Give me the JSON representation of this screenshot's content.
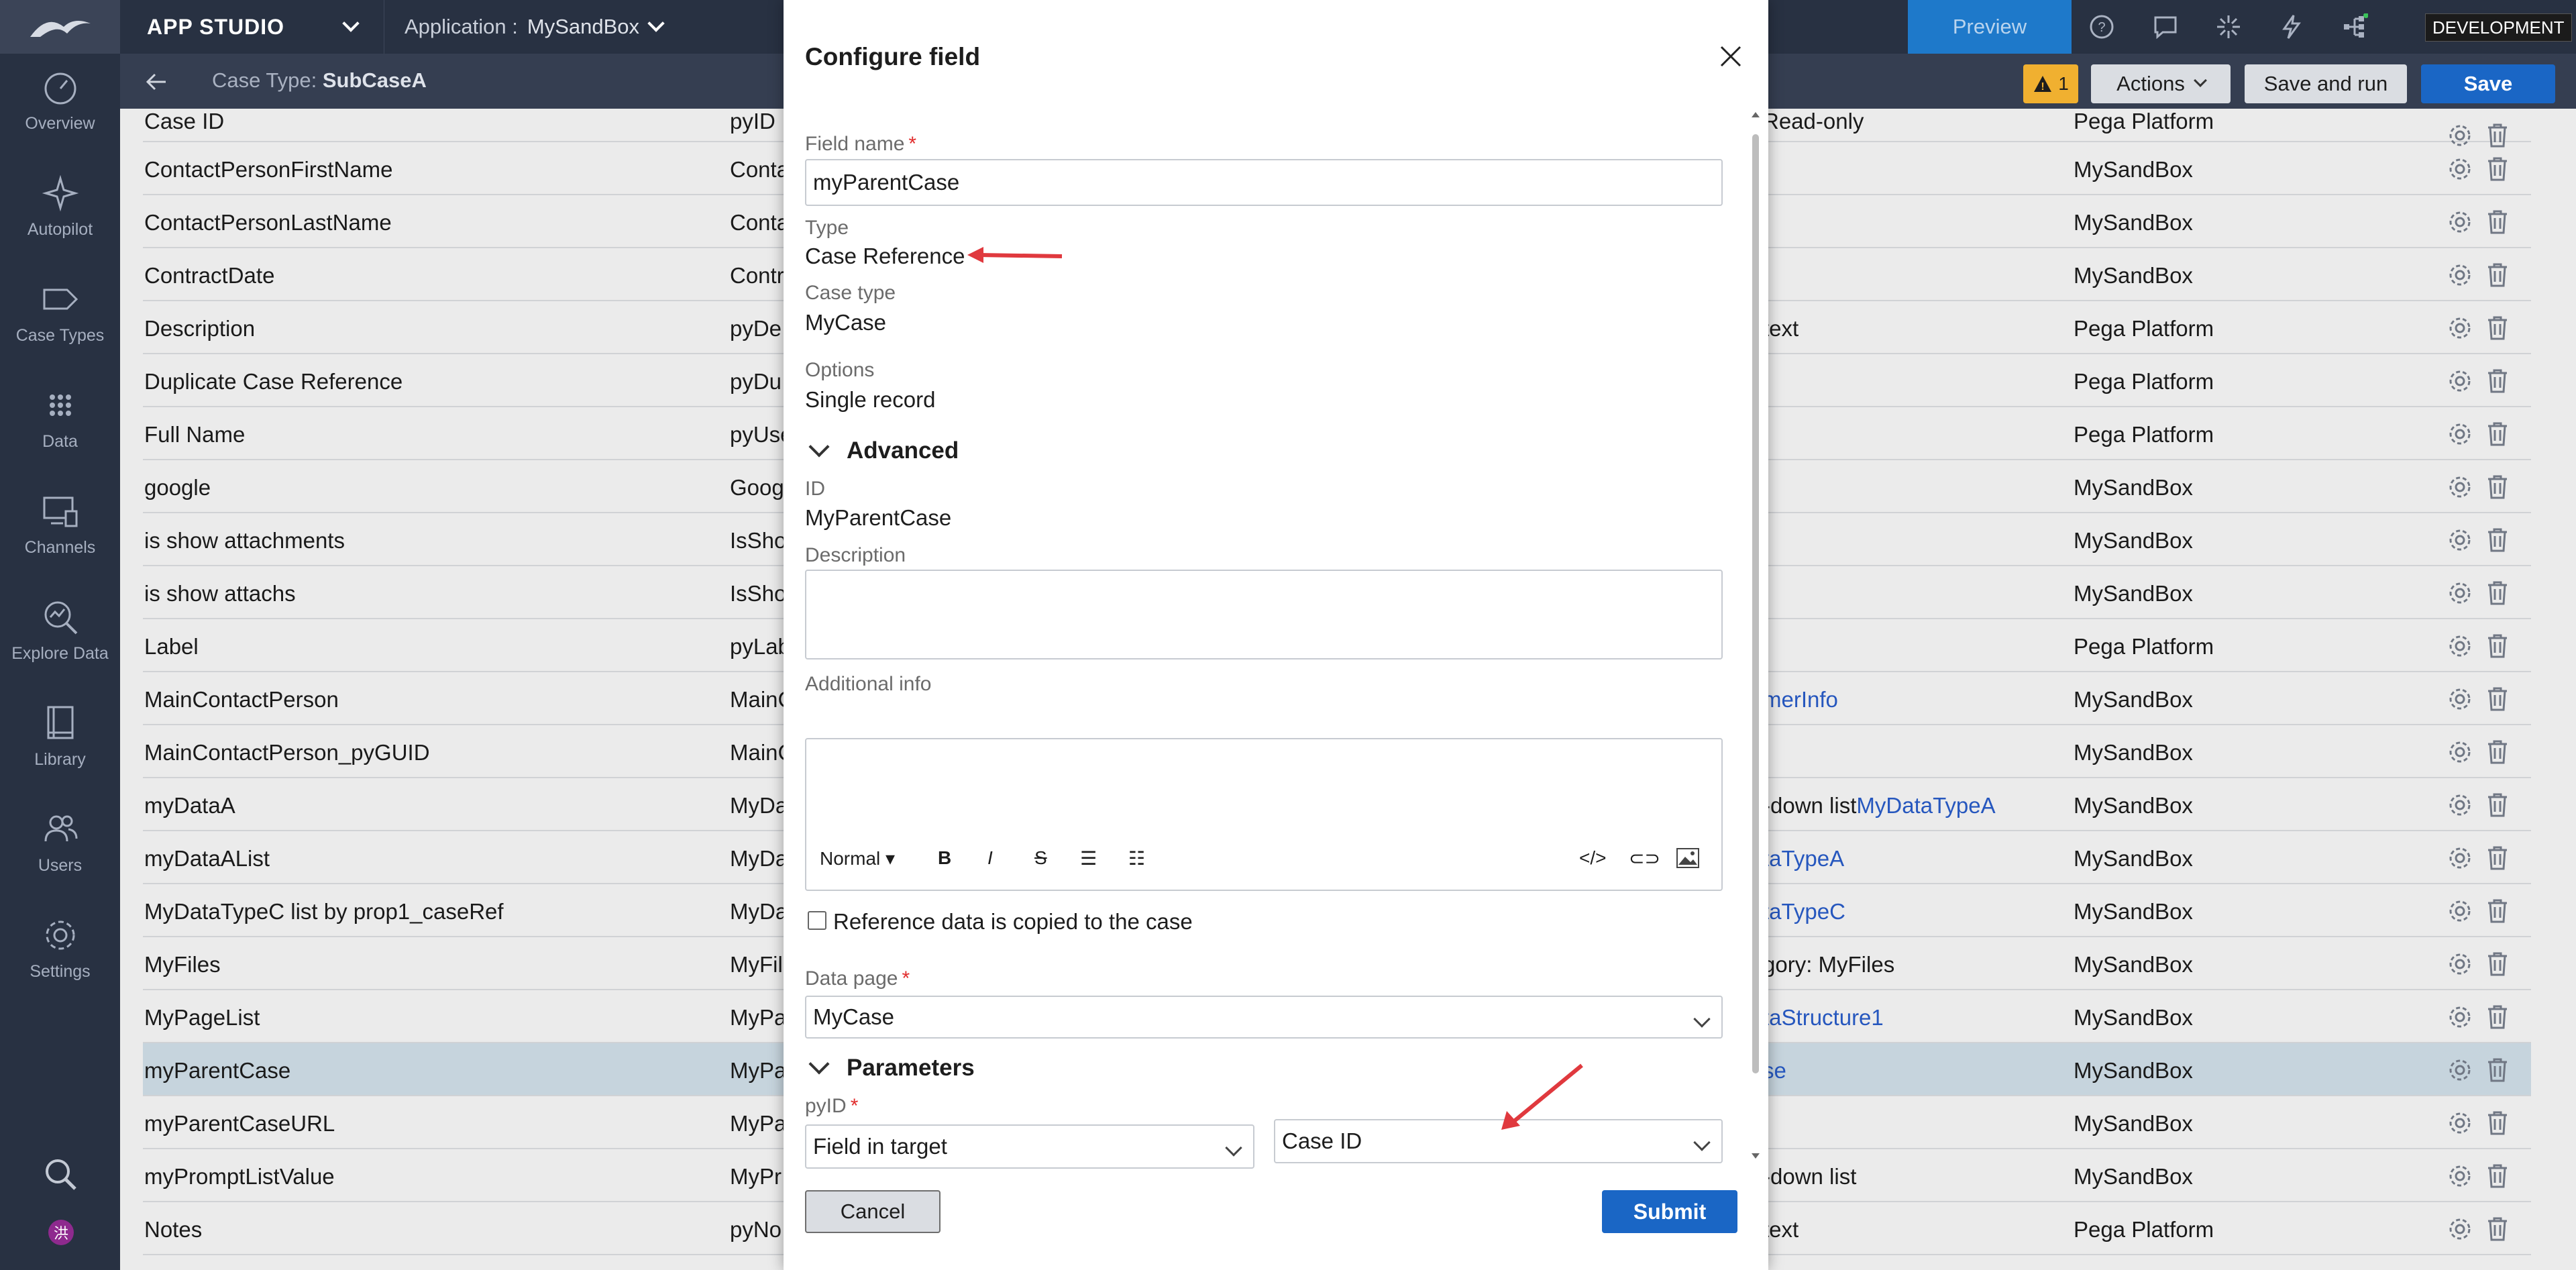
{
  "topbar": {
    "app_studio": "APP STUDIO",
    "application_label": "Application :",
    "application_name": "MySandBox",
    "preview": "Preview",
    "environment": "DEVELOPMENT"
  },
  "sidebar": {
    "items": [
      {
        "label": "Overview",
        "icon": "gauge-icon"
      },
      {
        "label": "Autopilot",
        "icon": "sparkle-icon"
      },
      {
        "label": "Case Types",
        "icon": "tag-icon"
      },
      {
        "label": "Data",
        "icon": "grid-dots-icon"
      },
      {
        "label": "Channels",
        "icon": "monitor-icon"
      },
      {
        "label": "Explore Data",
        "icon": "magnify-chart-icon"
      },
      {
        "label": "Library",
        "icon": "book-icon"
      },
      {
        "label": "Users",
        "icon": "users-icon"
      },
      {
        "label": "Settings",
        "icon": "gear-icon"
      }
    ],
    "avatar_initial": "洪"
  },
  "subheader": {
    "case_type_label": "Case Type:",
    "case_type_name": "SubCaseA",
    "warning_count": "1",
    "actions": "Actions",
    "save_and_run": "Save and run",
    "save": "Save"
  },
  "table": {
    "rows": [
      {
        "name": "Case ID",
        "id": "pyID",
        "type": "Read-only",
        "source": "Pega Platform",
        "link": false
      },
      {
        "name": "ContactPersonFirstName",
        "id": "Conta",
        "type": "",
        "source": "MySandBox",
        "link": false
      },
      {
        "name": "ContactPersonLastName",
        "id": "Conta",
        "type": "",
        "source": "MySandBox",
        "link": false
      },
      {
        "name": "ContractDate",
        "id": "Contr",
        "type": "",
        "source": "MySandBox",
        "link": false
      },
      {
        "name": "Description",
        "id": "pyDe",
        "type": "text",
        "source": "Pega Platform",
        "link": false
      },
      {
        "name": "Duplicate Case Reference",
        "id": "pyDu",
        "type": "",
        "source": "Pega Platform",
        "link": false
      },
      {
        "name": "Full Name",
        "id": "pyUse",
        "type": "",
        "source": "Pega Platform",
        "link": false
      },
      {
        "name": "google",
        "id": "Goog",
        "type": "",
        "source": "MySandBox",
        "link": false
      },
      {
        "name": "is show attachments",
        "id": "IsSho",
        "type": "",
        "source": "MySandBox",
        "link": false
      },
      {
        "name": "is show attachs",
        "id": "IsSho",
        "type": "",
        "source": "MySandBox",
        "link": false
      },
      {
        "name": "Label",
        "id": "pyLab",
        "type": "",
        "source": "Pega Platform",
        "link": false
      },
      {
        "name": "MainContactPerson",
        "id": "MainC",
        "type": "merInfo",
        "source": "MySandBox",
        "link": true
      },
      {
        "name": "MainContactPerson_pyGUID",
        "id": "MainC",
        "type": "",
        "source": "MySandBox",
        "link": false
      },
      {
        "name": "myDataA",
        "id": "MyDa",
        "type": "-down list",
        "type_link": "MyDataTypeA",
        "source": "MySandBox",
        "link": false
      },
      {
        "name": "myDataAList",
        "id": "MyDa",
        "type": "taTypeA",
        "source": "MySandBox",
        "link": true
      },
      {
        "name": "MyDataTypeC list by prop1_caseRef",
        "id": "MyDa",
        "type": "taTypeC",
        "source": "MySandBox",
        "link": true
      },
      {
        "name": "MyFiles",
        "id": "MyFil",
        "type": "gory:  MyFiles",
        "source": "MySandBox",
        "link": false
      },
      {
        "name": "MyPageList",
        "id": "MyPa",
        "type": "taStructure1",
        "source": "MySandBox",
        "link": true
      },
      {
        "name": "myParentCase",
        "id": "MyPa",
        "type": "se",
        "source": "MySandBox",
        "link": true,
        "selected": true
      },
      {
        "name": "myParentCaseURL",
        "id": "MyPa",
        "type": "",
        "source": "MySandBox",
        "link": false
      },
      {
        "name": "myPromptListValue",
        "id": "MyPr",
        "type": "-down list",
        "source": "MySandBox",
        "link": false
      },
      {
        "name": "Notes",
        "id": "pyNo",
        "type": "text",
        "source": "Pega Platform",
        "link": false
      }
    ]
  },
  "modal": {
    "title": "Configure field",
    "field_name_label": "Field name",
    "field_name_value": "myParentCase",
    "type_label": "Type",
    "type_value": "Case Reference",
    "case_type_label": "Case type",
    "case_type_value": "MyCase",
    "options_label": "Options",
    "options_value": "Single record",
    "advanced_title": "Advanced",
    "id_label": "ID",
    "id_value": "MyParentCase",
    "description_label": "Description",
    "additional_info_label": "Additional info",
    "rte_format": "Normal",
    "checkbox_label": "Reference data is copied to the case",
    "data_page_label": "Data page",
    "data_page_value": "MyCase",
    "parameters_title": "Parameters",
    "param_label": "pyID",
    "param_source_value": "Field in target",
    "param_target_value": "Case ID",
    "cancel": "Cancel",
    "submit": "Submit"
  },
  "colors": {
    "topbar_bg": "#283142",
    "accent_blue": "#1a66c5",
    "warning": "#f0b030",
    "arrow_red": "#e0393e"
  }
}
